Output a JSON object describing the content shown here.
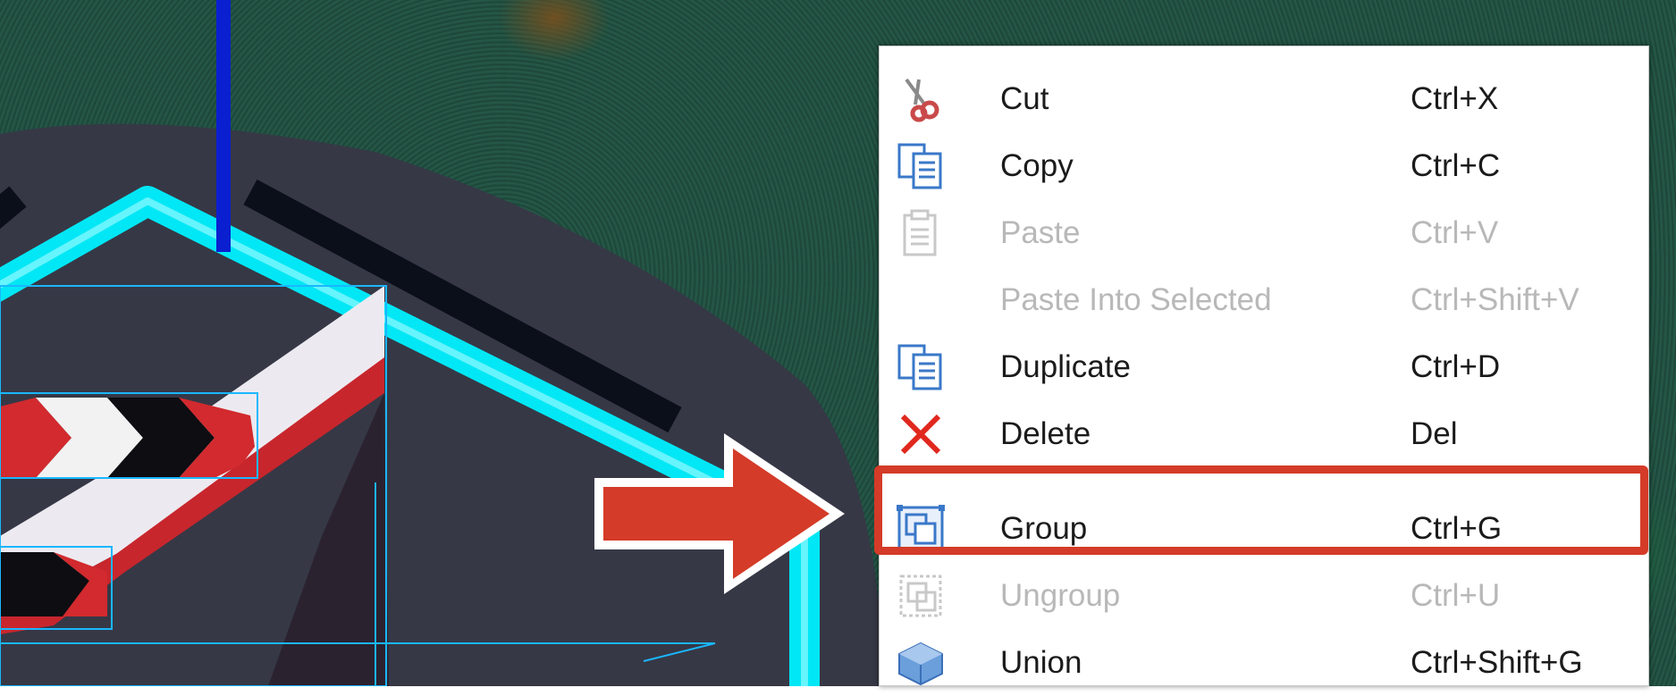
{
  "context_menu": {
    "items": [
      {
        "label": "Cut",
        "shortcut": "Ctrl+X",
        "icon": "scissors-icon",
        "enabled": true
      },
      {
        "label": "Copy",
        "shortcut": "Ctrl+C",
        "icon": "copy-icon",
        "enabled": true
      },
      {
        "label": "Paste",
        "shortcut": "Ctrl+V",
        "icon": "paste-icon",
        "enabled": false
      },
      {
        "label": "Paste Into Selected",
        "shortcut": "Ctrl+Shift+V",
        "icon": "",
        "enabled": false
      },
      {
        "label": "Duplicate",
        "shortcut": "Ctrl+D",
        "icon": "duplicate-icon",
        "enabled": true
      },
      {
        "label": "Delete",
        "shortcut": "Del",
        "icon": "delete-icon",
        "enabled": true
      },
      {
        "label": "Group",
        "shortcut": "Ctrl+G",
        "icon": "group-icon",
        "enabled": true,
        "highlighted": true
      },
      {
        "label": "Ungroup",
        "shortcut": "Ctrl+U",
        "icon": "ungroup-icon",
        "enabled": false
      },
      {
        "label": "Union",
        "shortcut": "Ctrl+Shift+G",
        "icon": "union-icon",
        "enabled": true
      }
    ]
  },
  "colors": {
    "highlight_border": "#d43b28",
    "pointer_arrow": "#d43b28",
    "disabled_text": "#b8b8b8",
    "selection_outline": "#00e6ff"
  }
}
